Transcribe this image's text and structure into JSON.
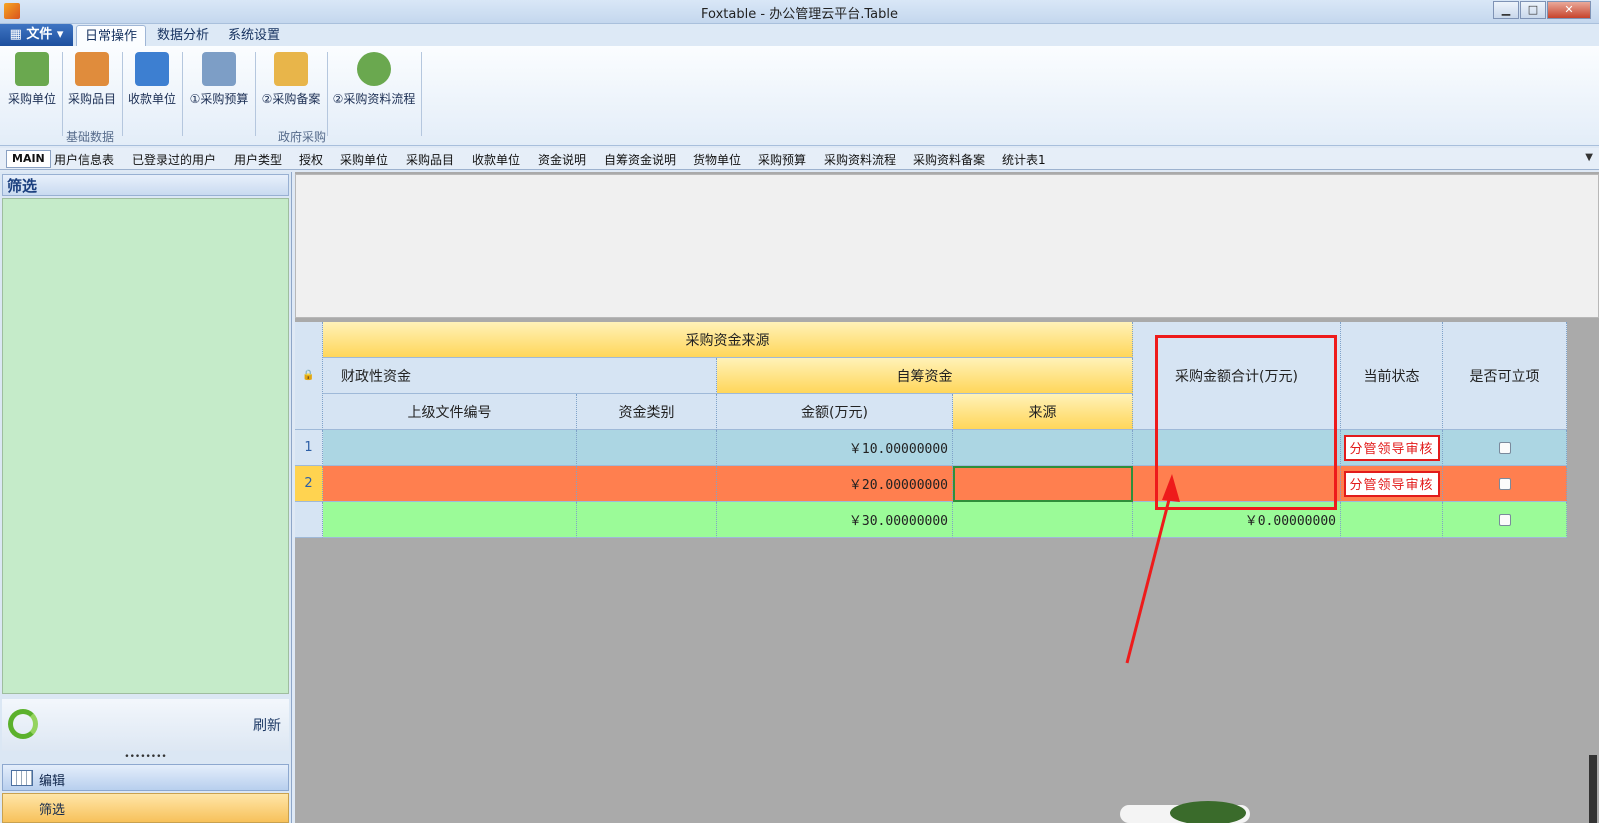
{
  "window": {
    "title": "Foxtable - 办公管理云平台.Table",
    "minimize": "▁",
    "maximize": "□",
    "close": "✕"
  },
  "menu": {
    "file_label": "▦ 文件 ▾",
    "tabs": [
      {
        "label": "日常操作"
      },
      {
        "label": "数据分析"
      },
      {
        "label": "系统设置"
      }
    ]
  },
  "ribbon": {
    "buttons": [
      {
        "label": "采购单位",
        "icon": "person-card-icon",
        "color": "#6aa84f"
      },
      {
        "label": "采购品目",
        "icon": "document-list-icon",
        "color": "#e08c3c"
      },
      {
        "label": "收款单位",
        "icon": "users-icon",
        "color": "#3d7fd1"
      },
      {
        "label": "①采购预算",
        "icon": "spreadsheet-icon",
        "color": "#7d9ec6"
      },
      {
        "label": "②采购备案",
        "icon": "folder-database-icon",
        "color": "#e8b54a"
      },
      {
        "label": "②采购资料流程",
        "icon": "help-flow-icon",
        "color": "#6aa84f"
      }
    ],
    "groups": [
      {
        "label": "基础数据"
      },
      {
        "label": "政府采购"
      }
    ]
  },
  "table_tabs": [
    "MAIN",
    "用户信息表",
    "已登录过的用户",
    "用户类型",
    "授权",
    "采购单位",
    "采购品目",
    "收款单位",
    "资金说明",
    "自筹资金说明",
    "货物单位",
    "采购预算",
    "采购资料流程",
    "采购资料备案",
    "统计表1"
  ],
  "left_panel": {
    "title": "筛选",
    "refresh_label": "刷新",
    "grip": "••••••••",
    "nav_items": [
      {
        "label": "编辑"
      },
      {
        "label": "筛选"
      }
    ]
  },
  "grid": {
    "header_top": "采购资金来源",
    "header_fiscal": "财政性资金",
    "header_self": "自筹资金",
    "col_doc": "上级文件编号",
    "col_type": "资金类别",
    "col_amount": "金额(万元)",
    "col_source": "来源",
    "col_total": "采购金额合计(万元)",
    "col_status": "当前状态",
    "col_approvable": "是否可立项",
    "lock": "🔒",
    "rows": [
      {
        "num": "1",
        "amount": "￥10.00000000",
        "total": "",
        "status": "分管领导审核"
      },
      {
        "num": "2",
        "amount": "￥20.00000000",
        "total": "",
        "status": "分管领导审核"
      },
      {
        "num": "",
        "amount": "￥30.00000000",
        "total": "￥0.00000000",
        "status": ""
      }
    ]
  },
  "colors": {
    "row1": "#acd6e3",
    "row2": "#ff7f4f",
    "summary": "#9bfb98",
    "annotation": "#ee1b1b"
  }
}
